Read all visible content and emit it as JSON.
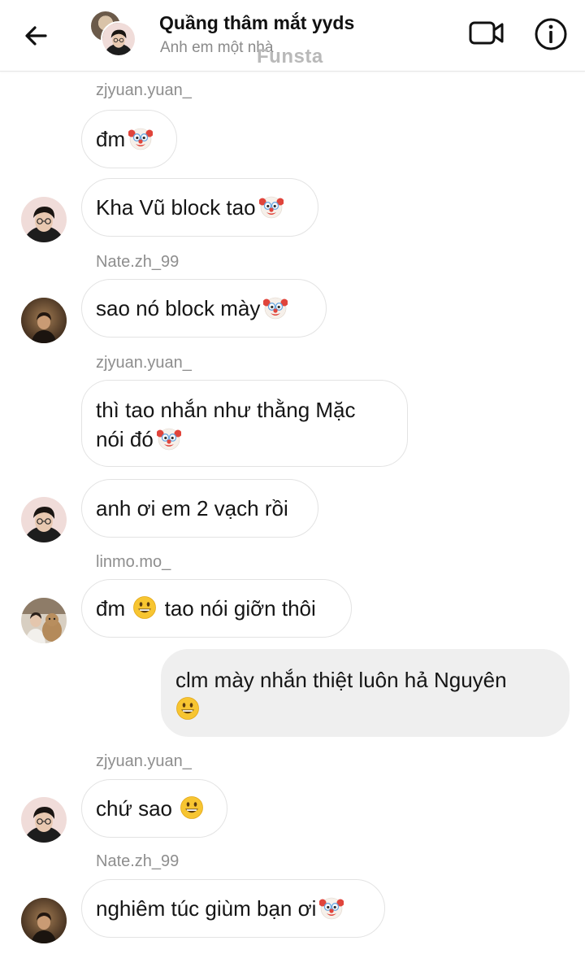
{
  "header": {
    "title": "Quầng thâm mắt yyds",
    "subtitle": "Anh em một nhà",
    "watermark": "Funsta"
  },
  "messages": [
    {
      "sender": "zjyuan.yuan_",
      "text": "đm",
      "emoji": "clown-face"
    },
    {
      "text": "Kha Vũ block tao",
      "emoji": "clown-face",
      "avatar": "zjyuan-avatar"
    },
    {
      "sender": "Nate.zh_99",
      "text": "sao nó block mày",
      "emoji": "clown-face",
      "avatar": "nate-avatar"
    },
    {
      "sender": "zjyuan.yuan_",
      "line1": "thì tao nhắn như thằng Mặc",
      "line2": "nói đó",
      "emoji": "clown-face"
    },
    {
      "text": "anh ơi em 2 vạch rồi",
      "avatar": "zjyuan-avatar"
    },
    {
      "sender": "linmo.mo_",
      "text_before": "đm",
      "text_after": "tao nói giỡn thôi",
      "emoji": "grinning-face",
      "avatar": "linmo-avatar"
    },
    {
      "own": true,
      "text": "clm mày nhắn thiệt luôn hả Nguyên",
      "emoji": "grinning-face"
    },
    {
      "sender": "zjyuan.yuan_",
      "text": "chứ sao",
      "emoji": "grinning-face",
      "avatar": "zjyuan-avatar"
    },
    {
      "sender": "Nate.zh_99",
      "text": "nghiêm túc giùm bạn ơi",
      "emoji": "clown-face",
      "avatar": "nate-avatar"
    }
  ],
  "icons": {
    "back": "arrow-left-icon",
    "video": "video-camera-icon",
    "info": "info-circle-icon"
  },
  "colors": {
    "own_bubble": "#efefef",
    "bubble_border": "#e3e3e3",
    "sender_text": "#8e8e8e",
    "subtitle_text": "#8a8a8a"
  }
}
